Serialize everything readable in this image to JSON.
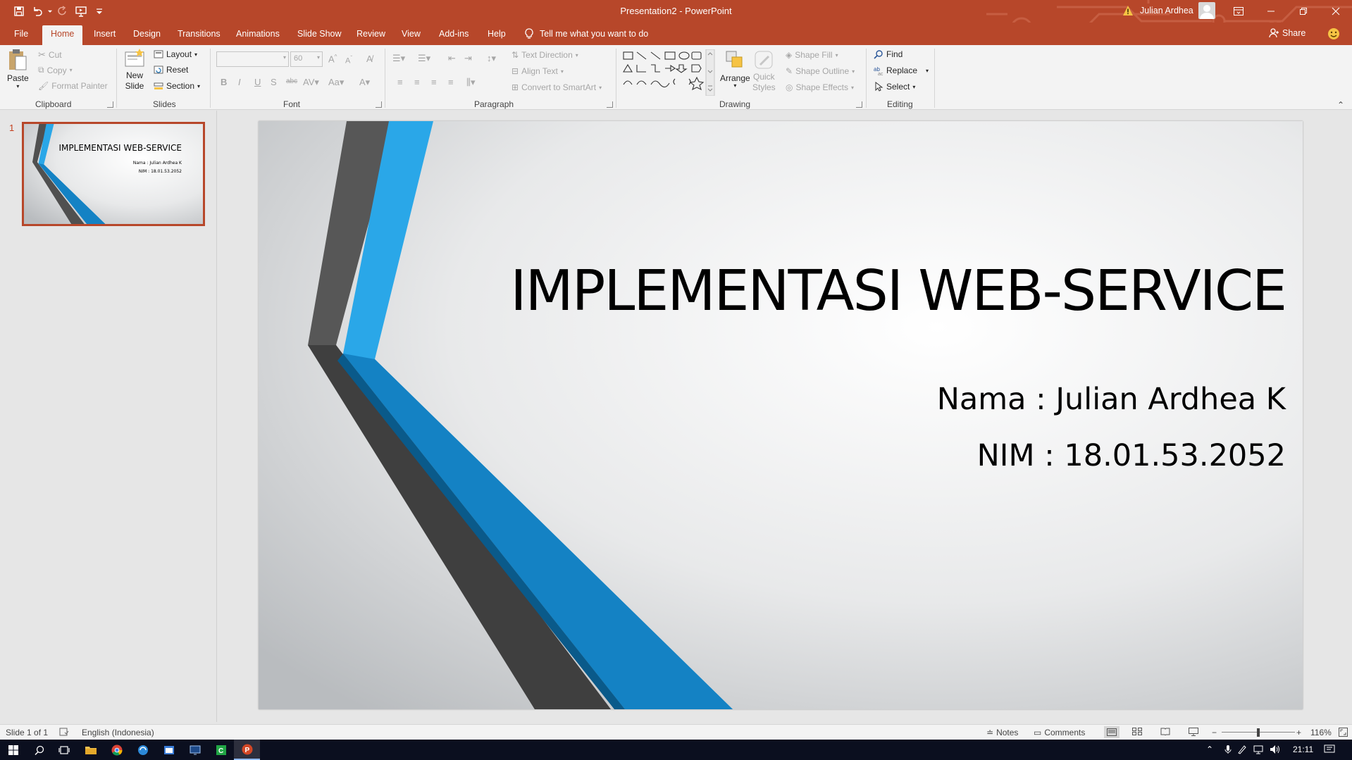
{
  "window": {
    "doc_title": "Presentation2  -  PowerPoint",
    "user_name": "Julian Ardhea"
  },
  "tabs": [
    {
      "label": "File"
    },
    {
      "label": "Home"
    },
    {
      "label": "Insert"
    },
    {
      "label": "Design"
    },
    {
      "label": "Transitions"
    },
    {
      "label": "Animations"
    },
    {
      "label": "Slide Show"
    },
    {
      "label": "Review"
    },
    {
      "label": "View"
    },
    {
      "label": "Add-ins"
    },
    {
      "label": "Help"
    }
  ],
  "tell_me": "Tell me what you want to do",
  "share_label": "Share",
  "ribbon": {
    "clipboard": {
      "label": "Clipboard",
      "paste": "Paste",
      "cut": "Cut",
      "copy": "Copy",
      "format_painter": "Format Painter"
    },
    "slides": {
      "label": "Slides",
      "new_slide_1": "New",
      "new_slide_2": "Slide",
      "layout": "Layout",
      "reset": "Reset",
      "section": "Section"
    },
    "font": {
      "label": "Font",
      "font_name": "",
      "font_size": "60"
    },
    "paragraph": {
      "label": "Paragraph",
      "text_direction": "Text Direction",
      "align_text": "Align Text",
      "convert_smartart": "Convert to SmartArt"
    },
    "drawing": {
      "label": "Drawing",
      "arrange": "Arrange",
      "quick_styles_1": "Quick",
      "quick_styles_2": "Styles",
      "shape_fill": "Shape Fill",
      "shape_outline": "Shape Outline",
      "shape_effects": "Shape Effects"
    },
    "editing": {
      "label": "Editing",
      "find": "Find",
      "replace": "Replace",
      "select": "Select"
    }
  },
  "thumbnails": [
    {
      "number": "1",
      "title": "IMPLEMENTASI WEB-SERVICE",
      "sub1": "Nama : Julian Ardhea K",
      "sub2": "NIM : 18.01.53.2052"
    }
  ],
  "slide": {
    "title": "IMPLEMENTASI WEB-SERVICE",
    "subtitle_line1": "Nama : Julian Ardhea K",
    "subtitle_line2": "NIM : 18.01.53.2052"
  },
  "status": {
    "slide_count": "Slide 1 of 1",
    "language": "English (Indonesia)",
    "notes": "Notes",
    "comments": "Comments",
    "zoom": "116%"
  },
  "taskbar": {
    "clock": "21:11"
  },
  "colors": {
    "accent": "#b7472a",
    "slide_blue": "#29a3e6",
    "slide_dark": "#404040"
  }
}
